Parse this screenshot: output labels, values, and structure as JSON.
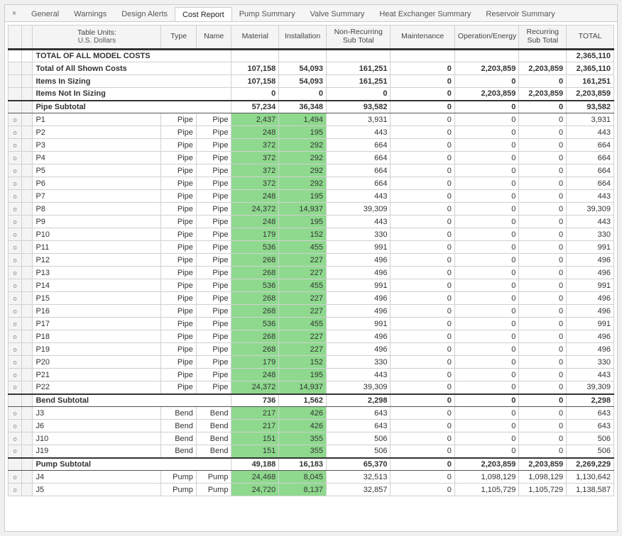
{
  "tabs": [
    "General",
    "Warnings",
    "Design Alerts",
    "Cost Report",
    "Pump Summary",
    "Valve Summary",
    "Heat Exchanger Summary",
    "Reservoir Summary"
  ],
  "active_tab_index": 3,
  "table_units_label": "Table Units:",
  "table_units_value": "U.S. Dollars",
  "columns": [
    "Type",
    "Name",
    "Material",
    "Installation",
    "Non-Recurring Sub Total",
    "Maintenance",
    "Operation/Energy",
    "Recurring Sub Total",
    "TOTAL"
  ],
  "summary_rows": [
    {
      "name": "TOTAL OF ALL MODEL COSTS",
      "material": "",
      "installation": "",
      "nonrec": "",
      "maint": "",
      "openergy": "",
      "rec": "",
      "total": "2,365,110",
      "style": "total-all"
    },
    {
      "name": "Total of All Shown Costs",
      "material": "107,158",
      "installation": "54,093",
      "nonrec": "161,251",
      "maint": "0",
      "openergy": "2,203,859",
      "rec": "2,203,859",
      "total": "2,365,110",
      "style": "bold"
    },
    {
      "name": "Items In Sizing",
      "material": "107,158",
      "installation": "54,093",
      "nonrec": "161,251",
      "maint": "0",
      "openergy": "0",
      "rec": "0",
      "total": "161,251",
      "style": "bold"
    },
    {
      "name": "Items Not In Sizing",
      "material": "0",
      "installation": "0",
      "nonrec": "0",
      "maint": "0",
      "openergy": "2,203,859",
      "rec": "2,203,859",
      "total": "2,203,859",
      "style": "bold"
    }
  ],
  "groups": [
    {
      "subtotal": {
        "name": "Pipe Subtotal",
        "material": "57,234",
        "installation": "36,348",
        "nonrec": "93,582",
        "maint": "0",
        "openergy": "0",
        "rec": "0",
        "total": "93,582"
      },
      "rows": [
        {
          "id": "P1",
          "type": "Pipe",
          "name": "Pipe",
          "material": "2,437",
          "installation": "1,494",
          "nonrec": "3,931",
          "maint": "0",
          "openergy": "0",
          "rec": "0",
          "total": "3,931"
        },
        {
          "id": "P2",
          "type": "Pipe",
          "name": "Pipe",
          "material": "248",
          "installation": "195",
          "nonrec": "443",
          "maint": "0",
          "openergy": "0",
          "rec": "0",
          "total": "443"
        },
        {
          "id": "P3",
          "type": "Pipe",
          "name": "Pipe",
          "material": "372",
          "installation": "292",
          "nonrec": "664",
          "maint": "0",
          "openergy": "0",
          "rec": "0",
          "total": "664"
        },
        {
          "id": "P4",
          "type": "Pipe",
          "name": "Pipe",
          "material": "372",
          "installation": "292",
          "nonrec": "664",
          "maint": "0",
          "openergy": "0",
          "rec": "0",
          "total": "664"
        },
        {
          "id": "P5",
          "type": "Pipe",
          "name": "Pipe",
          "material": "372",
          "installation": "292",
          "nonrec": "664",
          "maint": "0",
          "openergy": "0",
          "rec": "0",
          "total": "664"
        },
        {
          "id": "P6",
          "type": "Pipe",
          "name": "Pipe",
          "material": "372",
          "installation": "292",
          "nonrec": "664",
          "maint": "0",
          "openergy": "0",
          "rec": "0",
          "total": "664"
        },
        {
          "id": "P7",
          "type": "Pipe",
          "name": "Pipe",
          "material": "248",
          "installation": "195",
          "nonrec": "443",
          "maint": "0",
          "openergy": "0",
          "rec": "0",
          "total": "443"
        },
        {
          "id": "P8",
          "type": "Pipe",
          "name": "Pipe",
          "material": "24,372",
          "installation": "14,937",
          "nonrec": "39,309",
          "maint": "0",
          "openergy": "0",
          "rec": "0",
          "total": "39,309"
        },
        {
          "id": "P9",
          "type": "Pipe",
          "name": "Pipe",
          "material": "248",
          "installation": "195",
          "nonrec": "443",
          "maint": "0",
          "openergy": "0",
          "rec": "0",
          "total": "443"
        },
        {
          "id": "P10",
          "type": "Pipe",
          "name": "Pipe",
          "material": "179",
          "installation": "152",
          "nonrec": "330",
          "maint": "0",
          "openergy": "0",
          "rec": "0",
          "total": "330"
        },
        {
          "id": "P11",
          "type": "Pipe",
          "name": "Pipe",
          "material": "536",
          "installation": "455",
          "nonrec": "991",
          "maint": "0",
          "openergy": "0",
          "rec": "0",
          "total": "991"
        },
        {
          "id": "P12",
          "type": "Pipe",
          "name": "Pipe",
          "material": "268",
          "installation": "227",
          "nonrec": "496",
          "maint": "0",
          "openergy": "0",
          "rec": "0",
          "total": "496"
        },
        {
          "id": "P13",
          "type": "Pipe",
          "name": "Pipe",
          "material": "268",
          "installation": "227",
          "nonrec": "496",
          "maint": "0",
          "openergy": "0",
          "rec": "0",
          "total": "496"
        },
        {
          "id": "P14",
          "type": "Pipe",
          "name": "Pipe",
          "material": "536",
          "installation": "455",
          "nonrec": "991",
          "maint": "0",
          "openergy": "0",
          "rec": "0",
          "total": "991"
        },
        {
          "id": "P15",
          "type": "Pipe",
          "name": "Pipe",
          "material": "268",
          "installation": "227",
          "nonrec": "496",
          "maint": "0",
          "openergy": "0",
          "rec": "0",
          "total": "496"
        },
        {
          "id": "P16",
          "type": "Pipe",
          "name": "Pipe",
          "material": "268",
          "installation": "227",
          "nonrec": "496",
          "maint": "0",
          "openergy": "0",
          "rec": "0",
          "total": "496"
        },
        {
          "id": "P17",
          "type": "Pipe",
          "name": "Pipe",
          "material": "536",
          "installation": "455",
          "nonrec": "991",
          "maint": "0",
          "openergy": "0",
          "rec": "0",
          "total": "991"
        },
        {
          "id": "P18",
          "type": "Pipe",
          "name": "Pipe",
          "material": "268",
          "installation": "227",
          "nonrec": "496",
          "maint": "0",
          "openergy": "0",
          "rec": "0",
          "total": "496"
        },
        {
          "id": "P19",
          "type": "Pipe",
          "name": "Pipe",
          "material": "268",
          "installation": "227",
          "nonrec": "496",
          "maint": "0",
          "openergy": "0",
          "rec": "0",
          "total": "496"
        },
        {
          "id": "P20",
          "type": "Pipe",
          "name": "Pipe",
          "material": "179",
          "installation": "152",
          "nonrec": "330",
          "maint": "0",
          "openergy": "0",
          "rec": "0",
          "total": "330"
        },
        {
          "id": "P21",
          "type": "Pipe",
          "name": "Pipe",
          "material": "248",
          "installation": "195",
          "nonrec": "443",
          "maint": "0",
          "openergy": "0",
          "rec": "0",
          "total": "443"
        },
        {
          "id": "P22",
          "type": "Pipe",
          "name": "Pipe",
          "material": "24,372",
          "installation": "14,937",
          "nonrec": "39,309",
          "maint": "0",
          "openergy": "0",
          "rec": "0",
          "total": "39,309"
        }
      ]
    },
    {
      "subtotal": {
        "name": "Bend Subtotal",
        "material": "736",
        "installation": "1,562",
        "nonrec": "2,298",
        "maint": "0",
        "openergy": "0",
        "rec": "0",
        "total": "2,298"
      },
      "rows": [
        {
          "id": "J3",
          "type": "Bend",
          "name": "Bend",
          "material": "217",
          "installation": "426",
          "nonrec": "643",
          "maint": "0",
          "openergy": "0",
          "rec": "0",
          "total": "643"
        },
        {
          "id": "J6",
          "type": "Bend",
          "name": "Bend",
          "material": "217",
          "installation": "426",
          "nonrec": "643",
          "maint": "0",
          "openergy": "0",
          "rec": "0",
          "total": "643"
        },
        {
          "id": "J10",
          "type": "Bend",
          "name": "Bend",
          "material": "151",
          "installation": "355",
          "nonrec": "506",
          "maint": "0",
          "openergy": "0",
          "rec": "0",
          "total": "506"
        },
        {
          "id": "J19",
          "type": "Bend",
          "name": "Bend",
          "material": "151",
          "installation": "355",
          "nonrec": "506",
          "maint": "0",
          "openergy": "0",
          "rec": "0",
          "total": "506"
        }
      ]
    },
    {
      "subtotal": {
        "name": "Pump Subtotal",
        "material": "49,188",
        "installation": "16,183",
        "nonrec": "65,370",
        "maint": "0",
        "openergy": "2,203,859",
        "rec": "2,203,859",
        "total": "2,269,229"
      },
      "rows": [
        {
          "id": "J4",
          "type": "Pump",
          "name": "Pump",
          "material": "24,468",
          "installation": "8,045",
          "nonrec": "32,513",
          "maint": "0",
          "openergy": "1,098,129",
          "rec": "1,098,129",
          "total": "1,130,642"
        },
        {
          "id": "J5",
          "type": "Pump",
          "name": "Pump",
          "material": "24,720",
          "installation": "8,137",
          "nonrec": "32,857",
          "maint": "0",
          "openergy": "1,105,729",
          "rec": "1,105,729",
          "total": "1,138,587"
        }
      ]
    }
  ],
  "glyph": "o",
  "collapse_glyph": "«"
}
